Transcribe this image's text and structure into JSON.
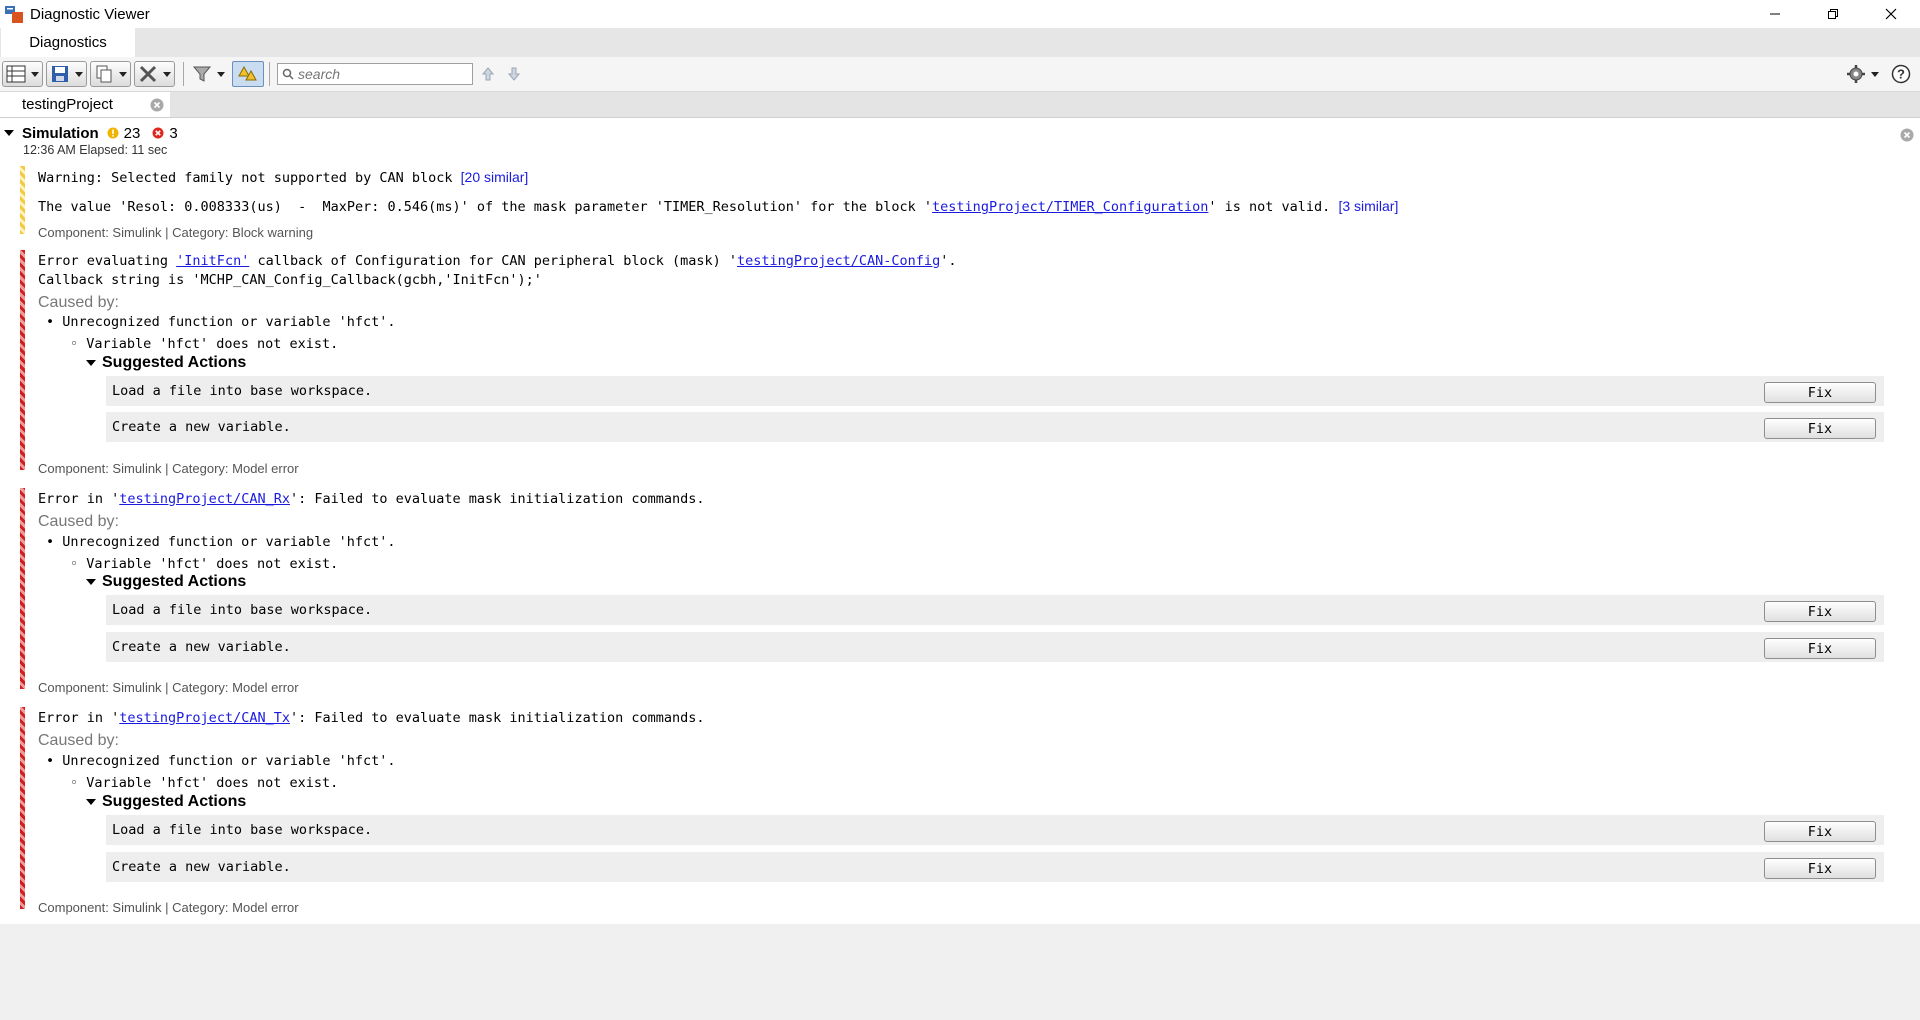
{
  "window": {
    "title": "Diagnostic Viewer"
  },
  "ribbon": {
    "tab_label": "Diagnostics"
  },
  "toolbar": {
    "search_placeholder": "search"
  },
  "doc_tab": {
    "label": "testingProject"
  },
  "simulation": {
    "title": "Simulation",
    "warning_count": "23",
    "error_count": "3",
    "time_text": "12:36 AM  Elapsed: 11 sec"
  },
  "warnings": {
    "w1_text": "Warning: Selected family not supported by CAN block ",
    "w1_similar": "[20 similar]",
    "w2_text_a": "The value 'Resol: 0.008333(us)  -  MaxPer: 0.546(ms)' of the mask parameter 'TIMER_Resolution' for the block '",
    "w2_link": "testingProject/TIMER_Configuration",
    "w2_text_b": "' is not valid. ",
    "w2_similar": "[3 similar]",
    "meta": "Component:  Simulink | Category:  Block warning"
  },
  "error1": {
    "text_a": "Error evaluating ",
    "link1": "'InitFcn'",
    "text_b": " callback of Configuration for CAN peripheral block (mask) '",
    "link2": "testingProject/CAN-Config",
    "text_c": "'.",
    "line2": "Callback string is 'MCHP_CAN_Config_Callback(gcbh,'InitFcn');'",
    "meta": "Component:  Simulink | Category:  Model error"
  },
  "error2": {
    "text_a": "Error in '",
    "link": "testingProject/CAN_Rx",
    "text_b": "': Failed to evaluate mask initialization commands.",
    "meta": "Component:  Simulink | Category:  Model error"
  },
  "error3": {
    "text_a": "Error in '",
    "link": "testingProject/CAN_Tx",
    "text_b": "': Failed to evaluate mask initialization commands.",
    "meta": "Component:  Simulink | Category:  Model error"
  },
  "common": {
    "caused_by": "Caused by:",
    "cause1": "Unrecognized function or variable 'hfct'.",
    "cause2": "Variable 'hfct' does not exist.",
    "suggested": "Suggested Actions",
    "action1": "Load a file into base workspace.",
    "action2": "Create a new variable.",
    "fix": "Fix"
  },
  "colors": {
    "warning": "#f5c842",
    "error": "#d01e1e",
    "link": "#1a1ae0"
  }
}
